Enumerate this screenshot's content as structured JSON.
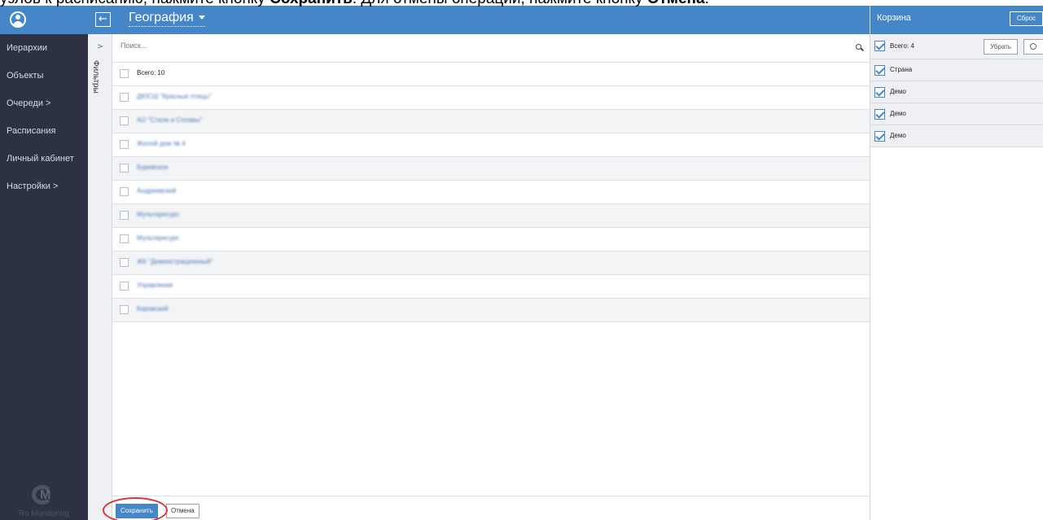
{
  "banner": {
    "text_prefix": "узлов к расписанию, нажмите кнопку ",
    "save_word": "Сохранить",
    "text_middle": ". Для отмены операции, нажмите кнопку ",
    "cancel_word": "Отмена",
    "text_suffix": "."
  },
  "header": {
    "back_glyph": "←",
    "title": "География"
  },
  "sidebar": {
    "items": [
      {
        "label": "Иерархии"
      },
      {
        "label": "Объекты"
      },
      {
        "label": "Очереди  >"
      },
      {
        "label": "Расписания"
      },
      {
        "label": "Личный кабинет"
      },
      {
        "label": "Настройки  >"
      }
    ],
    "logo_text": "Ro Monitoring"
  },
  "filters": {
    "toggle_glyph": ">",
    "label": "Фильтры"
  },
  "search": {
    "placeholder": "Поиск..."
  },
  "list": {
    "total": "Всего: 10",
    "rows": [
      {
        "label": "ДЮСШ \"Красные птицы\""
      },
      {
        "label": "АО \"Стали и Сплавы\""
      },
      {
        "label": "Жилой дом № 4"
      },
      {
        "label": "Буревское"
      },
      {
        "label": "Андреевский"
      },
      {
        "label": "Мультиресурс"
      },
      {
        "label": "Мультиресурс"
      },
      {
        "label": "ЖК \"Демонстрационный\""
      },
      {
        "label": "Управление"
      },
      {
        "label": "Кировский"
      }
    ]
  },
  "footer": {
    "save_label": "Сохранить",
    "cancel_label": "Отмена"
  },
  "cart": {
    "title": "Корзина",
    "reset_label": "Сброс",
    "total": "Всего: 4",
    "remove_label": "Убрать",
    "items": [
      {
        "label": "Страна"
      },
      {
        "label": "Демо"
      },
      {
        "label": "Демо"
      },
      {
        "label": "Демо"
      }
    ]
  },
  "colors": {
    "accent": "#4486c8",
    "sidebar": "#2c3241",
    "highlight": "#d9363e"
  }
}
